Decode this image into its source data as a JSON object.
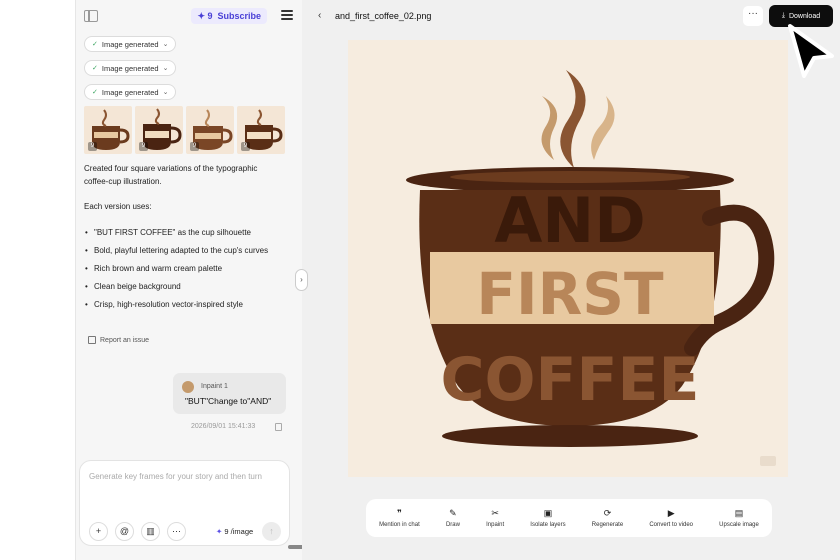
{
  "header": {
    "credits": "✦ 9",
    "subscribe_label": "Subscribe"
  },
  "chat": {
    "pills": [
      {
        "label": "Image generated"
      },
      {
        "label": "Image generated"
      },
      {
        "label": "Image generated"
      }
    ],
    "thumbnail_badge": "9",
    "summary_line1": "Created four square variations of the typographic",
    "summary_line2": "coffee-cup illustration.",
    "each_version": "Each version uses:",
    "bullets": [
      "\"BUT FIRST COFFEE\" as the cup silhouette",
      "Bold, playful lettering adapted to the cup's curves",
      "Rich brown and warm cream palette",
      "Clean beige background",
      "Crisp, high-resolution vector-inspired style"
    ],
    "report_label": "Report an issue",
    "user_message": {
      "tag": "Inpaint 1",
      "text": "\"BUT\"Change to\"AND\"",
      "timestamp": "2026/09/01 15:41:33"
    },
    "composer": {
      "placeholder": "Generate key frames for your story and then turn",
      "price_icon": "✦",
      "price": "9 /image"
    }
  },
  "viewer": {
    "file_name": "and_first_coffee_02.png",
    "more_label": "···",
    "download_label": "Download",
    "image": {
      "line1": "AND",
      "line2": "FIRST",
      "line3": "COFFEE"
    },
    "tools": [
      {
        "icon": "quote-icon",
        "glyph": "❞",
        "label": "Mention in chat"
      },
      {
        "icon": "pen-icon",
        "glyph": "✎",
        "label": "Draw"
      },
      {
        "icon": "scissors-icon",
        "glyph": "✂",
        "label": "Inpaint"
      },
      {
        "icon": "layers-icon",
        "glyph": "▣",
        "label": "Isolate layers"
      },
      {
        "icon": "refresh-icon",
        "glyph": "⟳",
        "label": "Regenerate"
      },
      {
        "icon": "video-icon",
        "glyph": "▶",
        "label": "Convert to video"
      },
      {
        "icon": "hd-icon",
        "glyph": "▤",
        "label": "Upscale image"
      }
    ]
  },
  "colors": {
    "accent": "#4a40d6",
    "dark_brown": "#4a2412",
    "mid_brown": "#8a5532",
    "light_brown": "#b88659",
    "cream": "#f6ecdf",
    "tan": "#e8c9a0"
  }
}
